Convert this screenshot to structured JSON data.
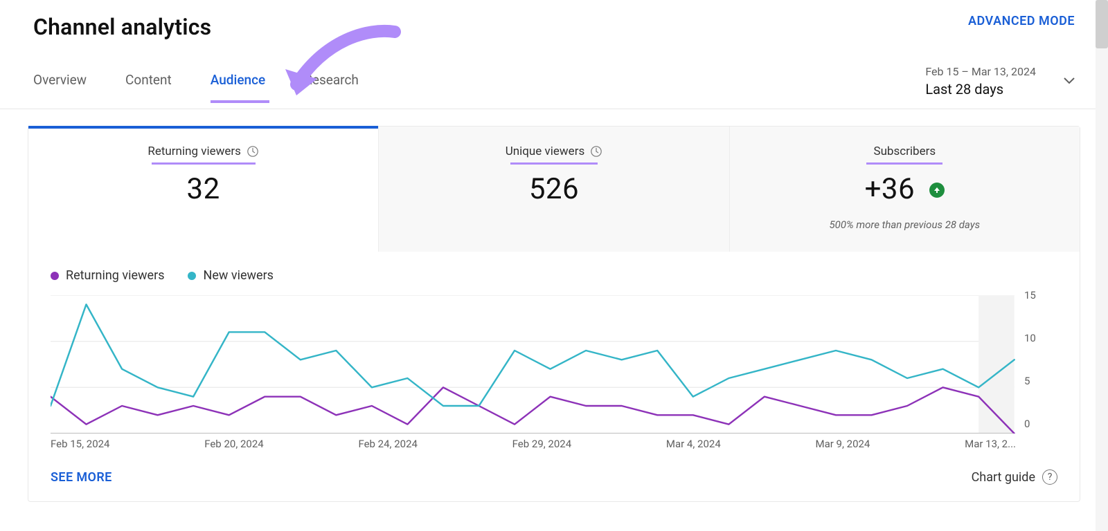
{
  "page_title": "Channel analytics",
  "advanced_mode_label": "ADVANCED MODE",
  "tabs": {
    "overview": "Overview",
    "content": "Content",
    "audience": "Audience",
    "research": "Research",
    "active": "audience"
  },
  "date_range": {
    "range_text": "Feb 15 – Mar 13, 2024",
    "preset_label": "Last 28 days"
  },
  "metrics": {
    "returning": {
      "label": "Returning viewers",
      "value": "32"
    },
    "unique": {
      "label": "Unique viewers",
      "value": "526"
    },
    "subs": {
      "label": "Subscribers",
      "value": "+36",
      "delta_note": "500% more than previous 28 days"
    }
  },
  "legend": {
    "returning": "Returning viewers",
    "new": "New viewers"
  },
  "footer": {
    "see_more": "SEE MORE",
    "chart_guide": "Chart guide"
  },
  "chart_data": {
    "type": "line",
    "xlabel": "",
    "ylabel": "",
    "ylim": [
      0,
      15
    ],
    "y_ticks": [
      15,
      10,
      5,
      0
    ],
    "x_ticks": [
      "Feb 15, 2024",
      "Feb 20, 2024",
      "Feb 24, 2024",
      "Feb 29, 2024",
      "Mar 4, 2024",
      "Mar 9, 2024",
      "Mar 13, 2..."
    ],
    "x": [
      "Feb 15",
      "Feb 16",
      "Feb 17",
      "Feb 18",
      "Feb 19",
      "Feb 20",
      "Feb 21",
      "Feb 22",
      "Feb 23",
      "Feb 24",
      "Feb 25",
      "Feb 26",
      "Feb 27",
      "Feb 28",
      "Feb 29",
      "Mar 1",
      "Mar 2",
      "Mar 3",
      "Mar 4",
      "Mar 5",
      "Mar 6",
      "Mar 7",
      "Mar 8",
      "Mar 9",
      "Mar 10",
      "Mar 11",
      "Mar 12",
      "Mar 13"
    ],
    "series": [
      {
        "name": "Returning viewers",
        "color": "#8d32b8",
        "values": [
          4,
          1,
          3,
          2,
          3,
          2,
          4,
          4,
          2,
          3,
          1,
          5,
          3,
          1,
          4,
          3,
          3,
          2,
          2,
          1,
          4,
          3,
          2,
          2,
          3,
          5,
          4,
          0
        ]
      },
      {
        "name": "New viewers",
        "color": "#34b5c7",
        "values": [
          3,
          14,
          7,
          5,
          4,
          11,
          11,
          8,
          9,
          5,
          6,
          3,
          3,
          9,
          7,
          9,
          8,
          9,
          4,
          6,
          7,
          8,
          9,
          8,
          6,
          7,
          5,
          8
        ]
      }
    ]
  },
  "colors": {
    "accent": "#1a5fd6",
    "purple_ann": "#b08cf9",
    "green": "#1e8e3e"
  }
}
